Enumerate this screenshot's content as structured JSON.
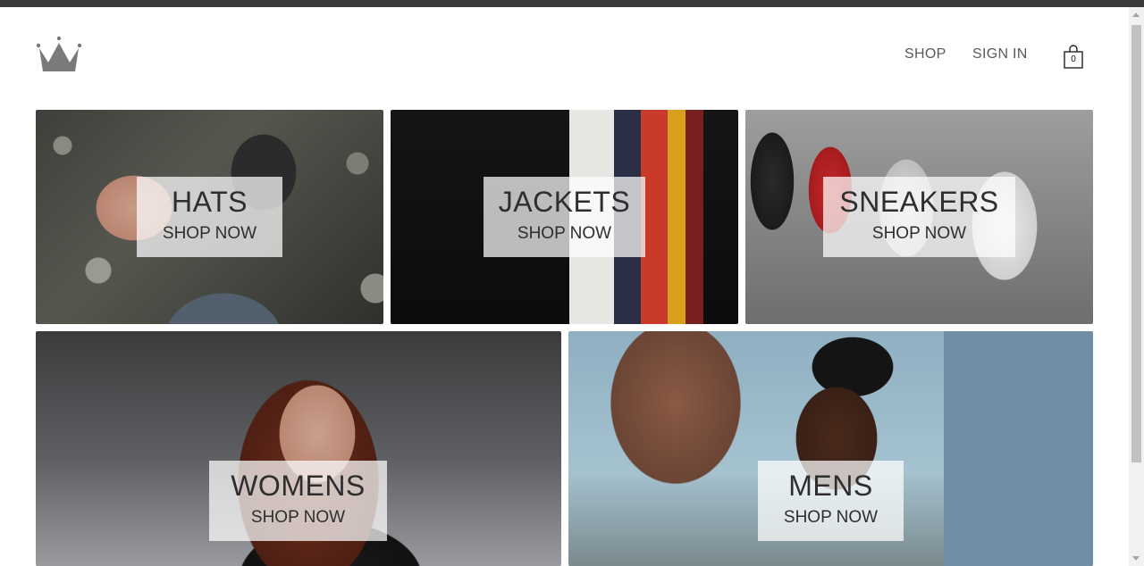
{
  "header": {
    "logo_icon": "crown-icon",
    "nav": [
      {
        "label": "SHOP"
      },
      {
        "label": "SIGN IN"
      }
    ],
    "cart": {
      "icon": "shopping-bag-icon",
      "count": "0"
    }
  },
  "categories": [
    {
      "title": "HATS",
      "cta": "SHOP NOW"
    },
    {
      "title": "JACKETS",
      "cta": "SHOP NOW"
    },
    {
      "title": "SNEAKERS",
      "cta": "SHOP NOW"
    },
    {
      "title": "WOMENS",
      "cta": "SHOP NOW"
    },
    {
      "title": "MENS",
      "cta": "SHOP NOW"
    }
  ],
  "colors": {
    "top_bar": "#3a3a3c",
    "nav_text": "#5a5a5a",
    "label_overlay": "rgba(255,255,255,0.72)",
    "label_text": "#2e2e2e"
  }
}
